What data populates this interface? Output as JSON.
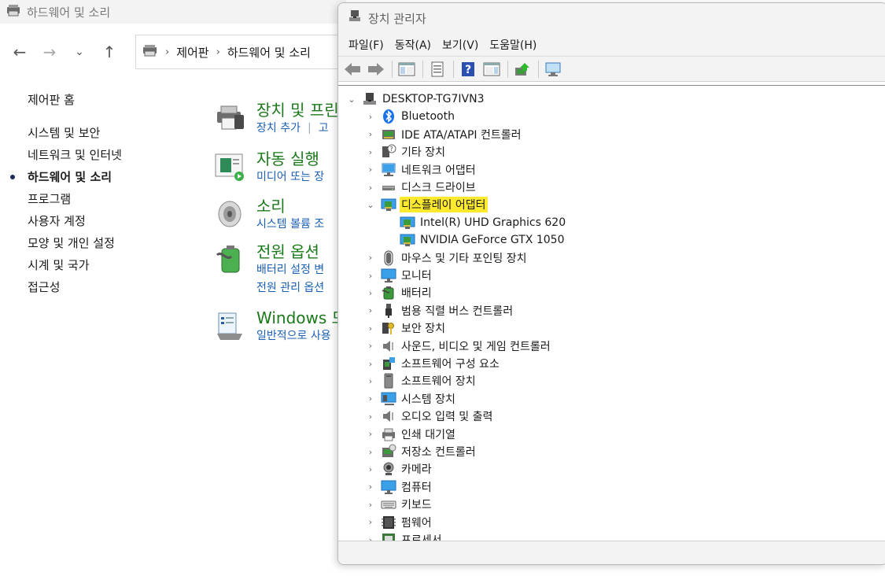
{
  "control_panel": {
    "window_title": "하드웨어 및 소리",
    "breadcrumb": [
      "제어판",
      "하드웨어 및 소리"
    ],
    "sidebar": {
      "home": "제어판 홈",
      "items": [
        {
          "label": "시스템 및 보안"
        },
        {
          "label": "네트워크 및 인터넷"
        },
        {
          "label": "하드웨어 및 소리",
          "active": true
        },
        {
          "label": "프로그램"
        },
        {
          "label": "사용자 계정"
        },
        {
          "label": "모양 및 개인 설정"
        },
        {
          "label": "시계 및 국가"
        },
        {
          "label": "접근성"
        }
      ]
    },
    "categories": [
      {
        "title": "장치 및 프린",
        "links": [
          "장치 추가",
          "고"
        ]
      },
      {
        "title": "자동 실행",
        "links": [
          "미디어 또는 장"
        ]
      },
      {
        "title": "소리",
        "links": [
          "시스템 볼륨 조"
        ]
      },
      {
        "title": "전원 옵션",
        "links": [
          "배터리 설정 변",
          "전원 관리 옵션"
        ]
      },
      {
        "title": "Windows 모",
        "links": [
          "일반적으로 사용"
        ]
      }
    ]
  },
  "device_manager": {
    "window_title": "장치 관리자",
    "menu": [
      "파일(F)",
      "동작(A)",
      "보기(V)",
      "도움말(H)"
    ],
    "root": "DESKTOP-TG7IVN3",
    "tree": [
      {
        "label": "Bluetooth",
        "icon": "bluetooth-icon"
      },
      {
        "label": "IDE ATA/ATAPI 컨트롤러",
        "icon": "ide-controller-icon"
      },
      {
        "label": "기타 장치",
        "icon": "unknown-device-icon"
      },
      {
        "label": "네트워크 어댑터",
        "icon": "network-adapter-icon"
      },
      {
        "label": "디스크 드라이브",
        "icon": "disk-drive-icon"
      },
      {
        "label": "디스플레이 어댑터",
        "icon": "display-adapter-icon",
        "expanded": true,
        "selected": true,
        "children": [
          {
            "label": "Intel(R) UHD Graphics 620",
            "icon": "display-adapter-icon"
          },
          {
            "label": "NVIDIA GeForce GTX 1050",
            "icon": "display-adapter-icon"
          }
        ]
      },
      {
        "label": "마우스 및 기타 포인팅 장치",
        "icon": "mouse-icon"
      },
      {
        "label": "모니터",
        "icon": "monitor-icon"
      },
      {
        "label": "배터리",
        "icon": "battery-icon"
      },
      {
        "label": "범용 직렬 버스 컨트롤러",
        "icon": "usb-icon"
      },
      {
        "label": "보안 장치",
        "icon": "security-device-icon"
      },
      {
        "label": "사운드, 비디오 및 게임 컨트롤러",
        "icon": "speaker-icon"
      },
      {
        "label": "소프트웨어 구성 요소",
        "icon": "software-component-icon"
      },
      {
        "label": "소프트웨어 장치",
        "icon": "software-device-icon"
      },
      {
        "label": "시스템 장치",
        "icon": "system-device-icon"
      },
      {
        "label": "오디오 입력 및 출력",
        "icon": "speaker-icon"
      },
      {
        "label": "인쇄 대기열",
        "icon": "printer-icon"
      },
      {
        "label": "저장소 컨트롤러",
        "icon": "storage-controller-icon"
      },
      {
        "label": "카메라",
        "icon": "camera-icon"
      },
      {
        "label": "컴퓨터",
        "icon": "computer-icon"
      },
      {
        "label": "키보드",
        "icon": "keyboard-icon"
      },
      {
        "label": "펌웨어",
        "icon": "firmware-icon"
      },
      {
        "label": "프로세서",
        "icon": "processor-icon"
      }
    ]
  },
  "colors": {
    "selection_highlight": "#fde92e",
    "category_title": "#1a7a1a",
    "link": "#1a5fb4"
  }
}
